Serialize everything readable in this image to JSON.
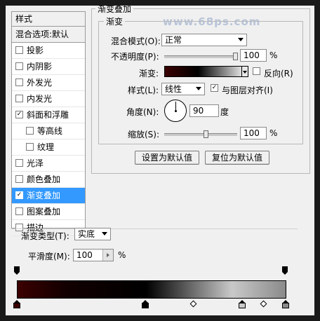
{
  "watermark": "www.68ps.com",
  "sidebar": {
    "header": "样式",
    "blend_default": "混合选项:默认",
    "items": [
      {
        "label": "投影",
        "checked": false
      },
      {
        "label": "内阴影",
        "checked": false
      },
      {
        "label": "外发光",
        "checked": false
      },
      {
        "label": "内发光",
        "checked": false
      },
      {
        "label": "斜面和浮雕",
        "checked": true
      },
      {
        "label": "等高线",
        "checked": false
      },
      {
        "label": "纹理",
        "checked": false
      },
      {
        "label": "光泽",
        "checked": false
      },
      {
        "label": "颜色叠加",
        "checked": false
      },
      {
        "label": "渐变叠加",
        "checked": true
      },
      {
        "label": "图案叠加",
        "checked": false
      },
      {
        "label": "描边",
        "checked": false
      }
    ],
    "check_mark": "✓"
  },
  "gradient_overlay": {
    "group_title": "渐变叠加",
    "sub_title": "渐变",
    "blend_mode_label": "混合模式(O):",
    "blend_mode_value": "正常",
    "opacity_label": "不透明度(P):",
    "opacity_value": "100",
    "opacity_percent": 100,
    "percent_sign": "%",
    "gradient_label": "渐变:",
    "reverse_label": "反向(R)",
    "reverse_checked": false,
    "style_label": "样式(L):",
    "style_value": "线性",
    "align_label": "与图层对齐(I)",
    "align_checked": true,
    "angle_label": "角度(N):",
    "angle_value": "90",
    "degree_unit": "度",
    "scale_label": "缩放(S):",
    "scale_value": "100",
    "scale_percent": 100,
    "set_default_button": "设置为默认值",
    "reset_default_button": "复位为默认值"
  },
  "gradient_editor": {
    "type_label": "渐变类型(T):",
    "type_value": "实底",
    "smoothness_label": "平滑度(M):",
    "smoothness_value": "100",
    "percent_sign": "%",
    "colors": {
      "stop_dark_red": "#3c0000",
      "stop_black": "#000000",
      "stop_light_gray": "#c9c9c9",
      "stop_gray": "#8a8a8a"
    }
  }
}
